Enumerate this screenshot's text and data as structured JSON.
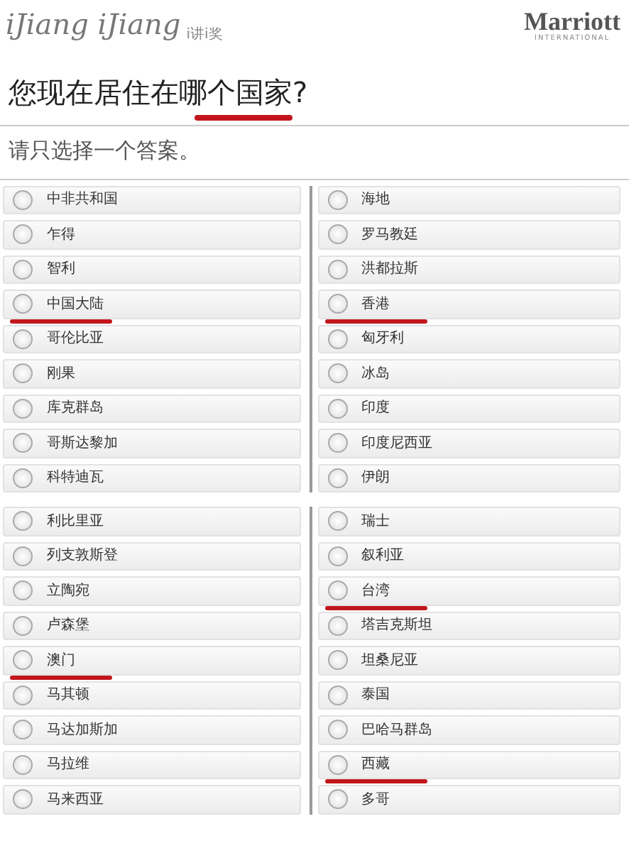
{
  "header": {
    "logo": "iJiang iJiang",
    "logo_sub": "i讲i奖",
    "brand": "Marriott",
    "brand_sub": "INTERNATIONAL"
  },
  "question": {
    "title": "您现在居住在哪个国家?",
    "underlined": true,
    "hint": "请只选择一个答案。"
  },
  "panels": [
    {
      "columns": [
        [
          {
            "label": "中非共和国",
            "selected": false,
            "underlined": false
          },
          {
            "label": "乍得",
            "selected": false,
            "underlined": false
          },
          {
            "label": "智利",
            "selected": false,
            "underlined": false
          },
          {
            "label": "中国大陆",
            "selected": false,
            "underlined": true
          },
          {
            "label": "哥伦比亚",
            "selected": false,
            "underlined": false
          },
          {
            "label": "刚果",
            "selected": false,
            "underlined": false
          },
          {
            "label": "库克群岛",
            "selected": false,
            "underlined": false
          },
          {
            "label": "哥斯达黎加",
            "selected": false,
            "underlined": false
          },
          {
            "label": "科特迪瓦",
            "selected": false,
            "underlined": false
          }
        ],
        [
          {
            "label": "海地",
            "selected": false,
            "underlined": false
          },
          {
            "label": "罗马教廷",
            "selected": false,
            "underlined": false
          },
          {
            "label": "洪都拉斯",
            "selected": false,
            "underlined": false
          },
          {
            "label": "香港",
            "selected": false,
            "underlined": true
          },
          {
            "label": "匈牙利",
            "selected": false,
            "underlined": false
          },
          {
            "label": "冰岛",
            "selected": false,
            "underlined": false
          },
          {
            "label": "印度",
            "selected": false,
            "underlined": false
          },
          {
            "label": "印度尼西亚",
            "selected": false,
            "underlined": false
          },
          {
            "label": "伊朗",
            "selected": false,
            "underlined": false
          }
        ]
      ]
    },
    {
      "columns": [
        [
          {
            "label": "利比里亚",
            "selected": false,
            "underlined": false
          },
          {
            "label": "列支敦斯登",
            "selected": false,
            "underlined": false
          },
          {
            "label": "立陶宛",
            "selected": false,
            "underlined": false
          },
          {
            "label": "卢森堡",
            "selected": false,
            "underlined": false
          },
          {
            "label": "澳门",
            "selected": false,
            "underlined": true
          },
          {
            "label": "马其顿",
            "selected": false,
            "underlined": false
          },
          {
            "label": "马达加斯加",
            "selected": false,
            "underlined": false
          },
          {
            "label": "马拉维",
            "selected": false,
            "underlined": false
          },
          {
            "label": "马来西亚",
            "selected": false,
            "underlined": false
          }
        ],
        [
          {
            "label": "瑞士",
            "selected": false,
            "underlined": false
          },
          {
            "label": "叙利亚",
            "selected": false,
            "underlined": false
          },
          {
            "label": "台湾",
            "selected": false,
            "underlined": true
          },
          {
            "label": "塔吉克斯坦",
            "selected": false,
            "underlined": false
          },
          {
            "label": "坦桑尼亚",
            "selected": false,
            "underlined": false
          },
          {
            "label": "泰国",
            "selected": false,
            "underlined": false
          },
          {
            "label": "巴哈马群岛",
            "selected": false,
            "underlined": false
          },
          {
            "label": "西藏",
            "selected": false,
            "underlined": true
          },
          {
            "label": "多哥",
            "selected": false,
            "underlined": false
          }
        ]
      ]
    }
  ]
}
